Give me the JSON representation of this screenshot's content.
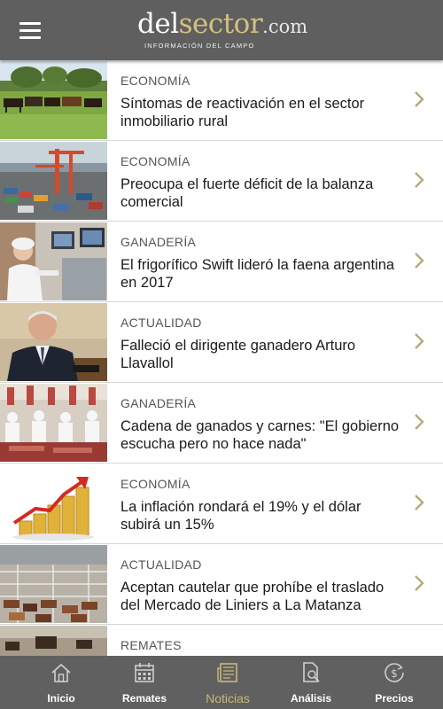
{
  "header": {
    "logo_part1": "del",
    "logo_part2": "sector",
    "logo_part3": ".com",
    "tagline": "INFORMACIÓN DEL CAMPO"
  },
  "articles": [
    {
      "category": "ECONOMÍA",
      "title": "Síntomas de reactivación en el sector inmobiliario rural",
      "image": "cattle-field"
    },
    {
      "category": "ECONOMÍA",
      "title": "Preocupa el fuerte déficit de la balanza comercial",
      "image": "port-cranes"
    },
    {
      "category": "GANADERÍA",
      "title": "El frigorífico Swift lideró la faena argentina en 2017",
      "image": "meat-plant-worker"
    },
    {
      "category": "ACTUALIDAD",
      "title": "Falleció el dirigente ganadero Arturo Llavallol",
      "image": "man-portrait"
    },
    {
      "category": "GANADERÍA",
      "title": "Cadena de ganados y carnes: \"El gobierno escucha pero no hace nada\"",
      "image": "meat-processing"
    },
    {
      "category": "ECONOMÍA",
      "title": "La inflación rondará el 19% y el dólar subirá un 15%",
      "image": "coin-stacks-arrow"
    },
    {
      "category": "ACTUALIDAD",
      "title": "Aceptan cautelar que prohíbe el traslado del Mercado de Liniers a La Matanza",
      "image": "cattle-market"
    },
    {
      "category": "REMATES",
      "title": "",
      "image": "cattle-auction"
    }
  ],
  "tabs": [
    {
      "label": "Inicio",
      "icon": "home-icon"
    },
    {
      "label": "Remates",
      "icon": "calendar-icon"
    },
    {
      "label": "Noticias",
      "icon": "newspaper-icon",
      "active": true
    },
    {
      "label": "Análisis",
      "icon": "document-search-icon"
    },
    {
      "label": "Precios",
      "icon": "dollar-icon"
    }
  ],
  "colors": {
    "header_bg": "#5f5f5f",
    "accent": "#c9b87a",
    "chevron": "#b5aa7a",
    "bottom_bar_bg": "#606060"
  }
}
